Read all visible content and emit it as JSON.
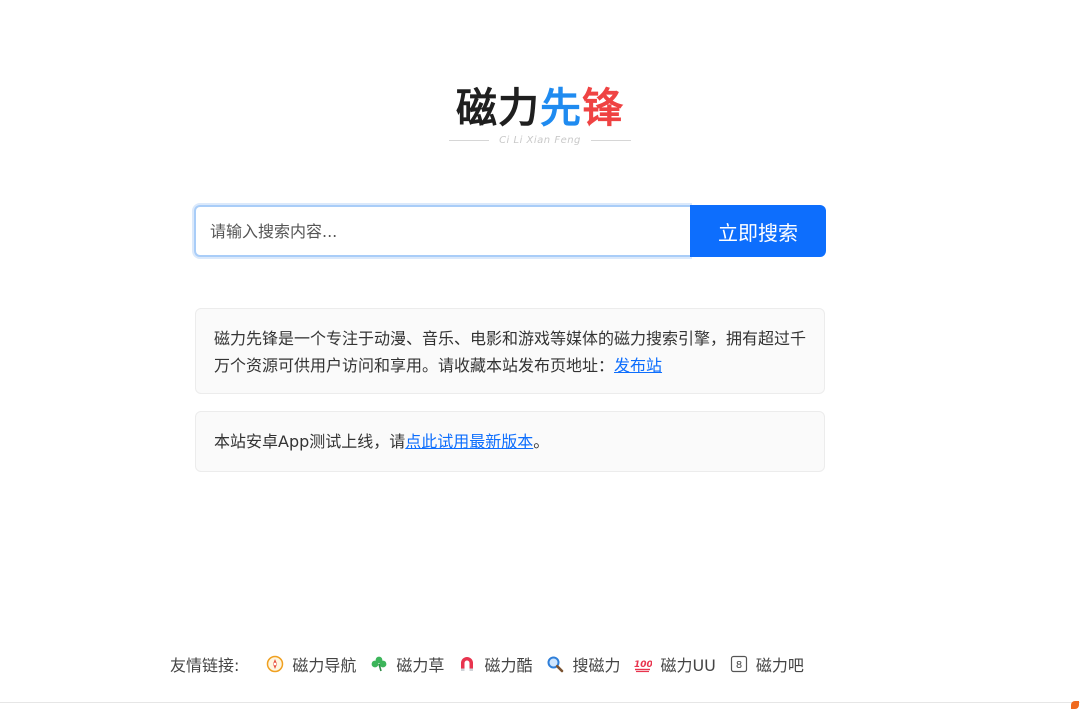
{
  "logo": {
    "part1": "磁力",
    "part2": "先",
    "part3": "锋",
    "subtitle": "Ci Li Xian Feng"
  },
  "search": {
    "placeholder": "请输入搜索内容...",
    "value": "",
    "button_label": "立即搜索"
  },
  "intro": {
    "text": "磁力先锋是一个专注于动漫、音乐、电影和游戏等媒体的磁力搜索引擎，拥有超过千万个资源可供用户访问和享用。请收藏本站发布页地址：",
    "link_label": "发布站"
  },
  "app_notice": {
    "prefix": "本站安卓App测试上线，请",
    "link_label": "点此试用最新版本",
    "suffix": "。"
  },
  "friends": {
    "label": "友情链接:",
    "links": [
      {
        "label": "磁力导航",
        "icon": "compass-icon"
      },
      {
        "label": "磁力草",
        "icon": "clover-icon"
      },
      {
        "label": "磁力酷",
        "icon": "magnet-icon"
      },
      {
        "label": "搜磁力",
        "icon": "magnifier-icon"
      },
      {
        "label": "磁力UU",
        "icon": "hundred-icon"
      },
      {
        "label": "磁力吧",
        "icon": "number-eight-icon"
      }
    ]
  },
  "colors": {
    "accent": "#0d6efd",
    "logo_blue": "#1f8bf0",
    "logo_red": "#ef4343"
  }
}
